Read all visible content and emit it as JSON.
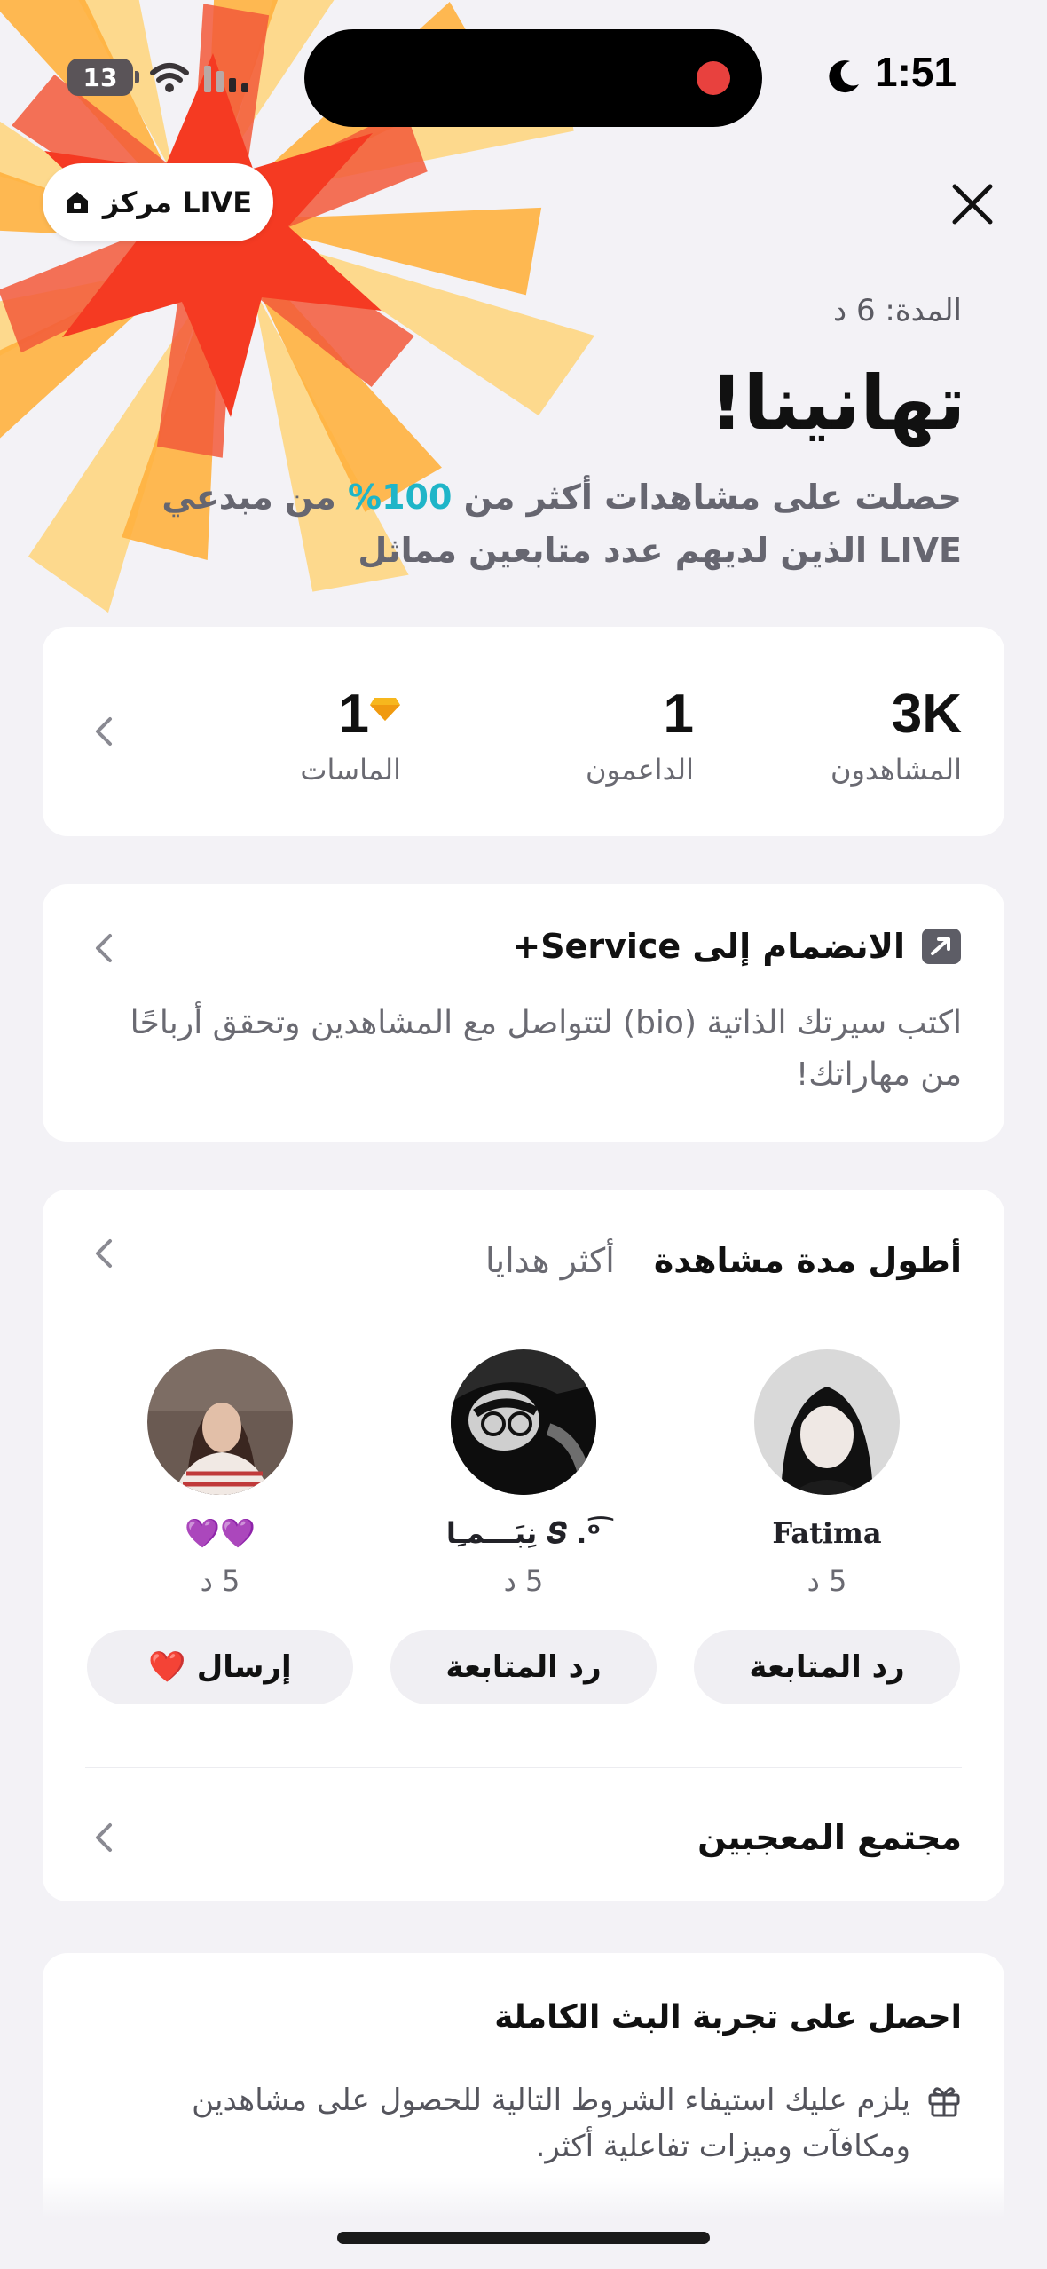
{
  "status_bar": {
    "battery": "13",
    "time": "1:51"
  },
  "header": {
    "live_center_label": "مركز LIVE",
    "duration": "المدة: 6 د",
    "title": "تهانينا!",
    "message_before": "حصلت على مشاهدات أكثر من ",
    "message_percent": "100%",
    "message_after": " من مبدعي LIVE الذين لديهم عدد متابعين مماثل"
  },
  "stats": {
    "viewers_value": "3K",
    "viewers_label": "المشاهدون",
    "supporters_value": "1",
    "supporters_label": "الداعمون",
    "diamonds_value": "1",
    "diamonds_label": "الماسات"
  },
  "service": {
    "title": "الانضمام إلى Service+",
    "description": "اكتب سيرتك الذاتية (bio) لتتواصل مع المشاهدين وتحقق أرباحًا من مهاراتك!"
  },
  "gifts": {
    "tab_watch_time": "أطول مدة مشاهدة",
    "tab_most_gifts": "أكثر هدايا",
    "viewers": [
      {
        "name": "Fatima",
        "duration": "5 د",
        "action": "رد المتابعة"
      },
      {
        "name": "ﻧِﺒَـــﻤـِﺎ 𝑺 .ᵒ͡",
        "duration": "5 د",
        "action": "رد المتابعة"
      },
      {
        "name": "💜💜",
        "duration": "5 د",
        "action": "إرسال",
        "action_emoji": "❤️"
      }
    ],
    "fans_label": "مجتمع المعجبين"
  },
  "experience": {
    "title": "احصل على تجربة البث الكاملة",
    "text": "يلزم عليك استيفاء الشروط التالية للحصول على مشاهدين ومكافآت وميزات تفاعلية أكثر."
  },
  "colors": {
    "accent_percent": "#1fb5c8",
    "background": "#f3f2f6",
    "record_dot": "#e8413e",
    "send_heart": "#e0303a"
  }
}
